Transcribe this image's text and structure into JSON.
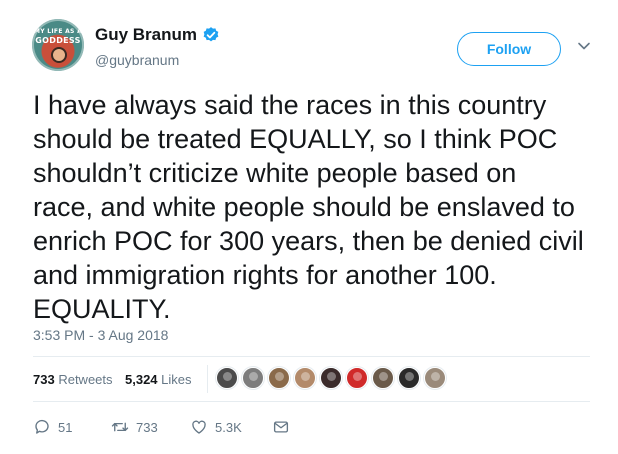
{
  "user": {
    "display_name": "Guy Branum",
    "handle": "@guybranum",
    "avatar_text_small": "MY LIFE AS A",
    "avatar_text_big": "GODDESS",
    "verified_icon": "verified-badge-icon"
  },
  "follow_label": "Follow",
  "tweet": {
    "lines": [
      "I have always said the races in this country",
      "should be treated EQUALLY, so I think POC",
      "shouldn’t criticize white people based on",
      "race, and white people should be enslaved to",
      "enrich POC for 300 years, then be denied civil",
      "and immigration rights for another 100.",
      "EQUALITY."
    ],
    "timestamp": "3:53 PM - 3 Aug 2018"
  },
  "stats": {
    "retweets_count": "733",
    "retweets_label": "Retweets",
    "likes_count": "5,324",
    "likes_label": "Likes"
  },
  "likers": [
    {
      "color": "#4b4b4b"
    },
    {
      "color": "#7d7d7d"
    },
    {
      "color": "#8a6a4a"
    },
    {
      "color": "#b38a6a"
    },
    {
      "color": "#3a2b2b"
    },
    {
      "color": "#d02a2a"
    },
    {
      "color": "#6a5a4a"
    },
    {
      "color": "#2a2a2a"
    },
    {
      "color": "#9a8a7a"
    }
  ],
  "actions": {
    "reply_count": "51",
    "retweet_count": "733",
    "like_count": "5.3K"
  },
  "colors": {
    "accent": "#1da1f2",
    "text": "#14171a",
    "secondary": "#657786"
  }
}
